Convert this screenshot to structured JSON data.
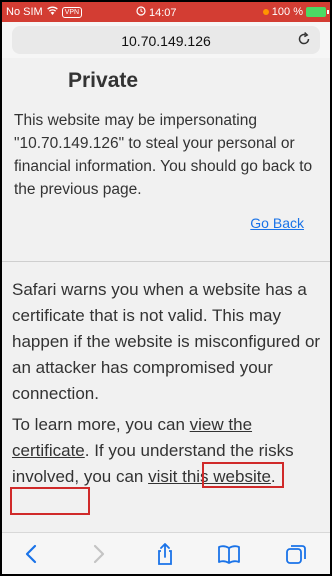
{
  "status_bar": {
    "carrier": "No SIM",
    "vpn": "VPN",
    "time": "14:07",
    "battery": "100 %"
  },
  "address_bar": {
    "url": "10.70.149.126"
  },
  "page": {
    "heading": "Private",
    "warning": "This website may be impersonating \"10.70.149.126\" to steal your personal or financial information. You should go back to the previous page.",
    "go_back": "Go Back",
    "info": "Safari warns you when a website has a certificate that is not valid. This may happen if the website is misconfigured or an attacker has compromised your connection.",
    "learn_prefix": "To learn more, you can ",
    "view_certificate": "view the certificate",
    "learn_middle": ". If you understand the risks involved, you can ",
    "visit_website": "visit this website",
    "learn_suffix": "."
  },
  "toolbar": {
    "icons": [
      "back-icon",
      "forward-icon",
      "share-icon",
      "bookmarks-icon",
      "tabs-icon"
    ]
  },
  "colors": {
    "status_bar": "#d33d33",
    "link": "#1a73e8",
    "highlight": "#d02a2a"
  }
}
